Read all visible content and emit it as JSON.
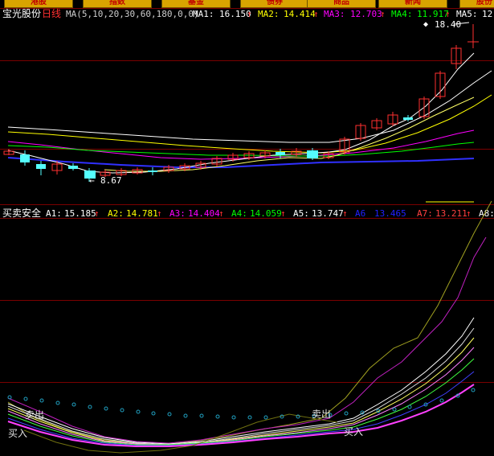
{
  "tabs": [
    {
      "label": "港股"
    },
    {
      "label": "指数"
    },
    {
      "label": "基金"
    },
    {
      "label": "债券"
    },
    {
      "label": "商品"
    },
    {
      "label": "新闻"
    },
    {
      "label": "股份"
    }
  ],
  "main_panel": {
    "stock_name": "宝光股份",
    "period": "日线",
    "ma_params": "MA(5,10,20,30,60,180,0,0)",
    "ma": [
      {
        "label": "MA1:",
        "value": "16.150",
        "arrow": "↑",
        "color": "#ffffff"
      },
      {
        "label": "MA2:",
        "value": "14.414",
        "arrow": "↑",
        "color": "#ffff00"
      },
      {
        "label": "MA3:",
        "value": "12.703",
        "arrow": "↑",
        "color": "#ff00ff"
      },
      {
        "label": "MA4:",
        "value": "11.917",
        "arrow": "↑",
        "color": "#00ff00"
      },
      {
        "label": "MA5:",
        "value": "12.",
        "arrow": "",
        "color": "#ffffff"
      }
    ],
    "high_label": "18.40",
    "low_label": "8.67",
    "colors": {
      "up": "#ff3030",
      "down": "#54ffff"
    }
  },
  "indicator_panel": {
    "name": "买卖安全",
    "items": [
      {
        "label": "A1:",
        "value": "15.185",
        "arrow": "↑",
        "color": "#ffffff"
      },
      {
        "label": "A2:",
        "value": "14.781",
        "arrow": "↑",
        "color": "#ffff00"
      },
      {
        "label": "A3:",
        "value": "14.404",
        "arrow": "↑",
        "color": "#ff00ff"
      },
      {
        "label": "A4:",
        "value": "14.059",
        "arrow": "↑",
        "color": "#00ff00"
      },
      {
        "label": "A5:",
        "value": "13.747",
        "arrow": "↑",
        "color": "#ffffff"
      },
      {
        "label": "A6",
        "value": "13.465",
        "arrow": "",
        "color": "#0000ff"
      },
      {
        "label": "A7:",
        "value": "13.211",
        "arrow": "↑",
        "color": "#ff4040"
      },
      {
        "label": "A8:",
        "value": "",
        "arrow": "",
        "color": "#ffffff"
      }
    ],
    "signals": [
      "卖出",
      "买入",
      "卖出",
      "买入"
    ]
  }
}
